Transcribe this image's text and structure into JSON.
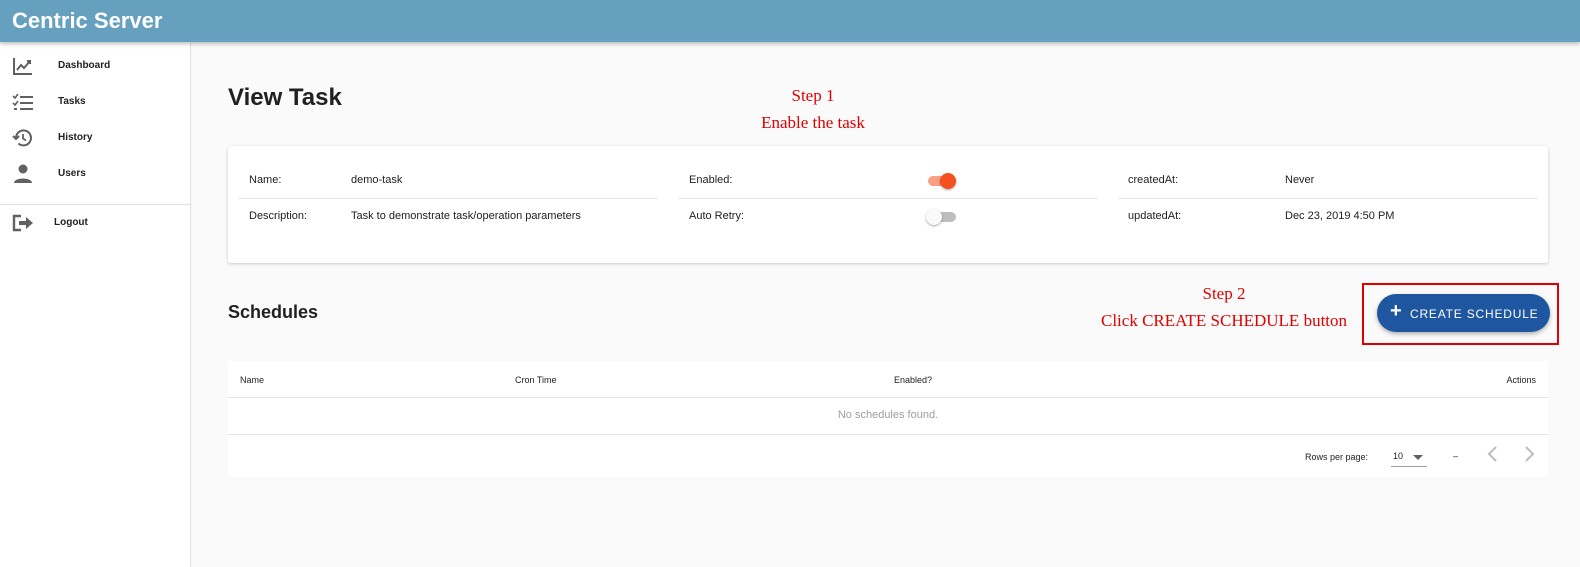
{
  "app": {
    "title": "Centric Server"
  },
  "sidebar": {
    "items": [
      {
        "label": "Dashboard",
        "icon": "chart-line-icon"
      },
      {
        "label": "Tasks",
        "icon": "checklist-icon"
      },
      {
        "label": "History",
        "icon": "history-icon"
      },
      {
        "label": "Users",
        "icon": "person-icon"
      }
    ],
    "logout": {
      "label": "Logout",
      "icon": "logout-icon"
    }
  },
  "page": {
    "title": "View Task"
  },
  "annotations": {
    "step1": {
      "title": "Step 1",
      "text": "Enable the task"
    },
    "step2": {
      "title": "Step 2",
      "text": "Click CREATE SCHEDULE button"
    }
  },
  "task": {
    "name_label": "Name:",
    "name_value": "demo-task",
    "description_label": "Description:",
    "description_value": "Task to demonstrate task/operation parameters",
    "enabled_label": "Enabled:",
    "enabled": true,
    "auto_retry_label": "Auto Retry:",
    "auto_retry": false,
    "created_label": "createdAt:",
    "created_value": "Never",
    "updated_label": "updatedAt:",
    "updated_value": "Dec 23, 2019 4:50 PM"
  },
  "schedules": {
    "title": "Schedules",
    "create_button": "CREATE SCHEDULE",
    "columns": [
      "Name",
      "Cron Time",
      "Enabled?",
      "Actions"
    ],
    "empty_text": "No schedules found.",
    "rows_per_page_label": "Rows per page:",
    "rows_per_page_value": "10",
    "range_text": "–"
  },
  "colors": {
    "appbar": "#65a0bf",
    "toggle_on": "#f4511e",
    "button": "#1e56a0",
    "annotation": "#e00000"
  }
}
